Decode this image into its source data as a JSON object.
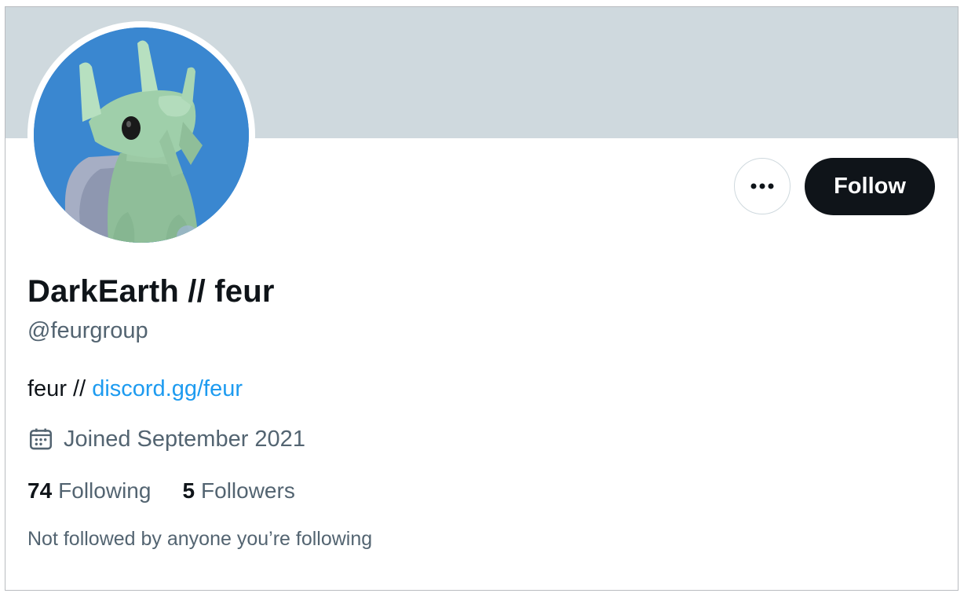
{
  "profile": {
    "display_name": "DarkEarth // feur",
    "handle": "@feurgroup",
    "bio_text": "feur // ",
    "bio_link": "discord.gg/feur",
    "joined": "Joined September 2021",
    "following_count": "74",
    "following_label": "Following",
    "followers_count": "5",
    "followers_label": "Followers",
    "not_followed_text": "Not followed by anyone you’re following"
  },
  "actions": {
    "follow_label": "Follow",
    "more_icon": "more-horizontal-icon"
  },
  "icons": {
    "joined": "calendar-icon"
  },
  "colors": {
    "banner": "#cfd9de",
    "avatar_bg": "#3a87d0",
    "follow_button": "#0f1419",
    "link": "#1d9bf0",
    "secondary_text": "#536471"
  }
}
